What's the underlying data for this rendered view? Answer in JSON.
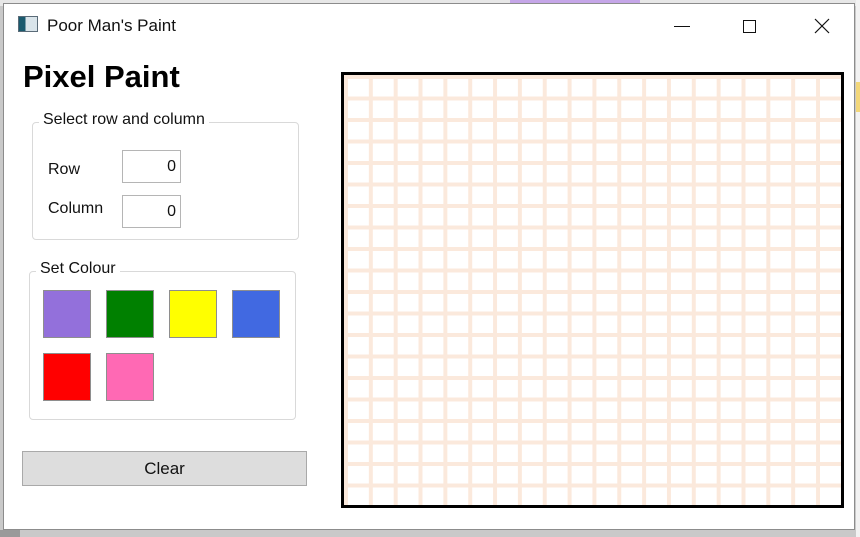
{
  "window": {
    "title": "Poor Man's Paint",
    "controls": {
      "minimize_glyph": "",
      "maximize_glyph": "",
      "close_glyph": "✕"
    }
  },
  "app": {
    "heading": "Pixel Paint"
  },
  "row_column_group": {
    "legend": "Select row and column",
    "row_label": "Row",
    "row_value": "0",
    "column_label": "Column",
    "column_value": "0"
  },
  "colour_group": {
    "legend": "Set Colour",
    "swatches": [
      {
        "name": "purple",
        "color": "#9370DB"
      },
      {
        "name": "green",
        "color": "#008000"
      },
      {
        "name": "yellow",
        "color": "#FFFF00"
      },
      {
        "name": "blue",
        "color": "#4169E1"
      },
      {
        "name": "red",
        "color": "#FF0000"
      },
      {
        "name": "pink",
        "color": "#FF69B4"
      }
    ]
  },
  "clear_button": {
    "label": "Clear"
  },
  "canvas": {
    "rows": 20,
    "columns": 20,
    "grid_line_color": "#FBE9DC",
    "border_color": "#000000"
  }
}
